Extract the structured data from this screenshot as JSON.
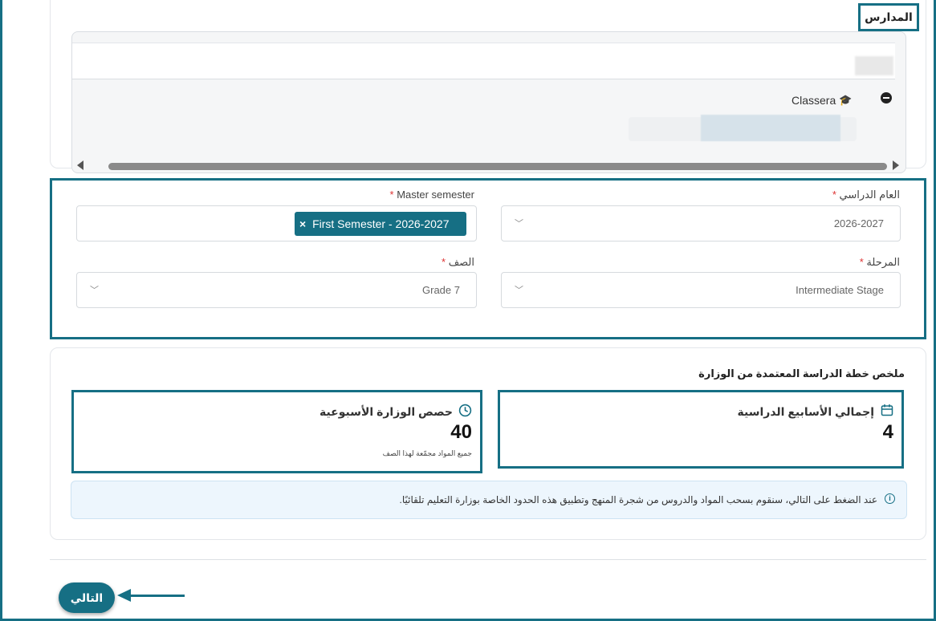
{
  "schools_section": {
    "title": "المدارس",
    "tree": {
      "node_label": "Classera",
      "node_icon": "graduation-cap-icon",
      "toggle_icon": "minus-circle-icon"
    }
  },
  "form": {
    "academic_year": {
      "label": "العام الدراسي",
      "required_mark": "*",
      "value": "2026-2027"
    },
    "master_semester": {
      "label": "Master semester",
      "required_mark": "*",
      "chip_label": "First Semester - 2026-2027",
      "chip_remove": "×"
    },
    "stage": {
      "label": "المرحلة",
      "required_mark": "*",
      "value": "Intermediate Stage"
    },
    "grade": {
      "label": "الصف",
      "required_mark": "*",
      "value": "Grade 7"
    }
  },
  "summary": {
    "title": "ملخص خطة الدراسة المعتمدة من الوزارة",
    "total_weeks": {
      "label": "إجمالي الأسابيع الدراسية",
      "value": "4",
      "icon": "calendar-icon"
    },
    "weekly_periods": {
      "label": "حصص الوزارة الأسبوعية",
      "value": "40",
      "note": "جميع المواد مجمّعة لهذا الصف",
      "icon": "clock-icon"
    },
    "info": "عند الضغط على التالي، سنقوم بسحب المواد والدروس من شجرة المنهج وتطبيق هذه الحدود الخاصة بوزارة التعليم تلقائيًا."
  },
  "footer": {
    "next_label": "التالي"
  },
  "colors": {
    "accent": "#166f84",
    "required": "#dd3333",
    "info_bg": "#edf6fd"
  }
}
